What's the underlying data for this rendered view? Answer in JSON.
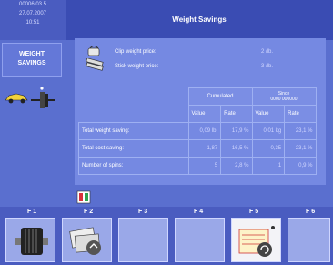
{
  "header": {
    "code": "00006  03.5",
    "date": "27.07.2007",
    "time": "10:51",
    "title": "Weight Savings"
  },
  "sidebar": {
    "mode_line1": "WEIGHT",
    "mode_line2": "SAVINGS"
  },
  "prices": {
    "clip_label": "Clip weight price:",
    "clip_value": "2 /lb.",
    "stick_label": "Stick weight price:",
    "stick_value": "3 /lb."
  },
  "table": {
    "col_group_1": "Cumulated",
    "col_group_2_line1": "Since",
    "col_group_2_line2": "0000 000000",
    "sub_value": "Value",
    "sub_rate": "Rate",
    "rows": [
      {
        "label": "Total weight saving:",
        "v1": "0,09 lb.",
        "r1": "17,9 %",
        "v2": "0,01 kg",
        "r2": "23,1 %"
      },
      {
        "label": "Total cost saving:",
        "v1": "1,87",
        "r1": "16,5 %",
        "v2": "0,35",
        "r2": "23,1 %"
      },
      {
        "label": "Number of spins:",
        "v1": "5",
        "r1": "2,8 %",
        "v2": "1",
        "r2": "0,9 %"
      }
    ]
  },
  "fkeys": [
    {
      "label": "F 1"
    },
    {
      "label": "F 2"
    },
    {
      "label": "F 3"
    },
    {
      "label": "F 4"
    },
    {
      "label": "F 5"
    },
    {
      "label": "F 6"
    }
  ],
  "colors": {
    "background": "#5a6fcf",
    "panel": "#7589e2",
    "topbar": "#3a4cb3"
  }
}
